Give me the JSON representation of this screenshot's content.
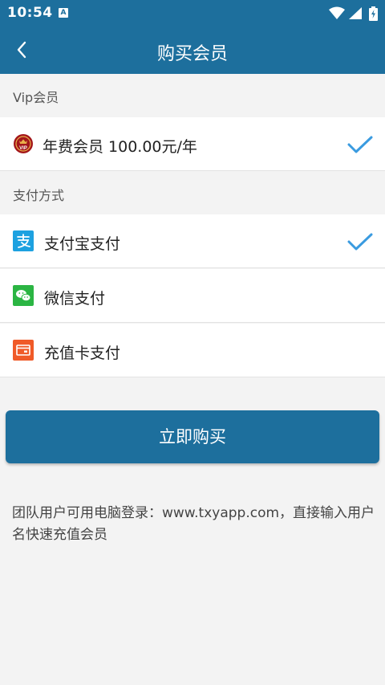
{
  "status_bar": {
    "time": "10:54",
    "notification_glyph": "A",
    "icons": [
      "wifi-icon",
      "signal-icon",
      "battery-charging-icon"
    ]
  },
  "app_bar": {
    "title": "购买会员",
    "back_icon": "back-arrow-icon"
  },
  "vip_section": {
    "label": "Vip会员",
    "plans": [
      {
        "label": "年费会员 100.00元/年",
        "icon": "vip-badge-icon",
        "selected": true
      }
    ]
  },
  "payment_section": {
    "label": "支付方式",
    "methods": [
      {
        "label": "支付宝支付",
        "icon": "alipay-icon",
        "selected": true
      },
      {
        "label": "微信支付",
        "icon": "wechat-icon",
        "selected": false
      },
      {
        "label": "充值卡支付",
        "icon": "prepaid-card-icon",
        "selected": false
      }
    ]
  },
  "buy_button": {
    "label": "立即购买"
  },
  "note": {
    "text": "团队用户可用电脑登录：www.txyapp.com，直接输入用户名快速充值会员"
  },
  "colors": {
    "primary": "#1d6f9d",
    "check": "#3a9be0",
    "alipay": "#1da1e0",
    "wechat": "#2bb543",
    "card": "#f05a28",
    "vip": "#a3161a"
  }
}
